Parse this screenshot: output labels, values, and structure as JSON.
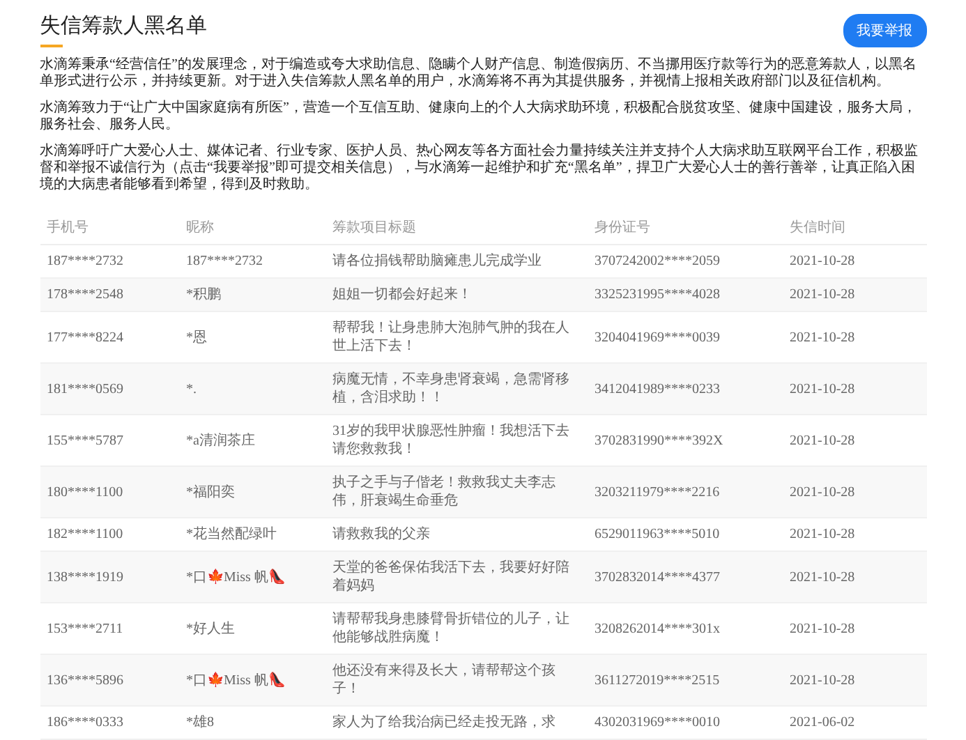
{
  "page": {
    "title": "失信筹款人黑名单",
    "report_button": "我要举报"
  },
  "paragraphs": [
    "水滴筹秉承“经营信任”的发展理念，对于编造或夸大求助信息、隐瞒个人财产信息、制造假病历、不当挪用医疗款等行为的恶意筹款人，以黑名单形式进行公示，并持续更新。对于进入失信筹款人黑名单的用户，水滴筹将不再为其提供服务，并视情上报相关政府部门以及征信机构。",
    "水滴筹致力于“让广大中国家庭病有所医”，营造一个互信互助、健康向上的个人大病求助环境，积极配合脱贫攻坚、健康中国建设，服务大局，服务社会、服务人民。",
    "水滴筹呼吁广大爱心人士、媒体记者、行业专家、医护人员、热心网友等各方面社会力量持续关注并支持个人大病求助互联网平台工作，积极监督和举报不诚信行为（点击“我要举报”即可提交相关信息），与水滴筹一起维护和扩充“黑名单”，捍卫广大爱心人士的善行善举，让真正陷入困境的大病患者能够看到希望，得到及时救助。"
  ],
  "table": {
    "columns": [
      "手机号",
      "昵称",
      "筹款项目标题",
      "身份证号",
      "失信时间"
    ],
    "rows": [
      [
        "187****2732",
        "187****2732",
        "请各位捐钱帮助脑瘫患儿完成学业",
        "3707242002****2059",
        "2021-10-28"
      ],
      [
        "178****2548",
        "*积鹏",
        "姐姐一切都会好起来！",
        "3325231995****4028",
        "2021-10-28"
      ],
      [
        "177****8224",
        "*恩",
        "帮帮我！让身患肺大泡肺气肿的我在人世上活下去！",
        "3204041969****0039",
        "2021-10-28"
      ],
      [
        "181****0569",
        "*.",
        "病魔无情，不幸身患肾衰竭，急需肾移植，含泪求助！！",
        "3412041989****0233",
        "2021-10-28"
      ],
      [
        "155****5787",
        "*a清润茶庄",
        "31岁的我甲状腺恶性肿瘤！我想活下去请您救救我！",
        "3702831990****392X",
        "2021-10-28"
      ],
      [
        "180****1100",
        "*福阳奕",
        "执子之手与子偕老！救救我丈夫李志伟，肝衰竭生命垂危",
        "3203211979****2216",
        "2021-10-28"
      ],
      [
        "182****1100",
        "*花当然配绿叶",
        "请救救我的父亲",
        "6529011963****5010",
        "2021-10-28"
      ],
      [
        "138****1919",
        "*口🍁Miss 帆👠",
        "天堂的爸爸保佑我活下去，我要好好陪着妈妈",
        "3702832014****4377",
        "2021-10-28"
      ],
      [
        "153****2711",
        "*好人生",
        "请帮帮我身患膝臂骨折错位的儿子，让他能够战胜病魔！",
        "3208262014****301x",
        "2021-10-28"
      ],
      [
        "136****5896",
        "*口🍁Miss 帆👠",
        "他还没有来得及长大，请帮帮这个孩子！",
        "3611272019****2515",
        "2021-10-28"
      ],
      [
        "186****0333",
        "*雄8",
        "家人为了给我治病已经走投无路，求",
        "4302031969****0010",
        "2021-06-02"
      ]
    ]
  }
}
